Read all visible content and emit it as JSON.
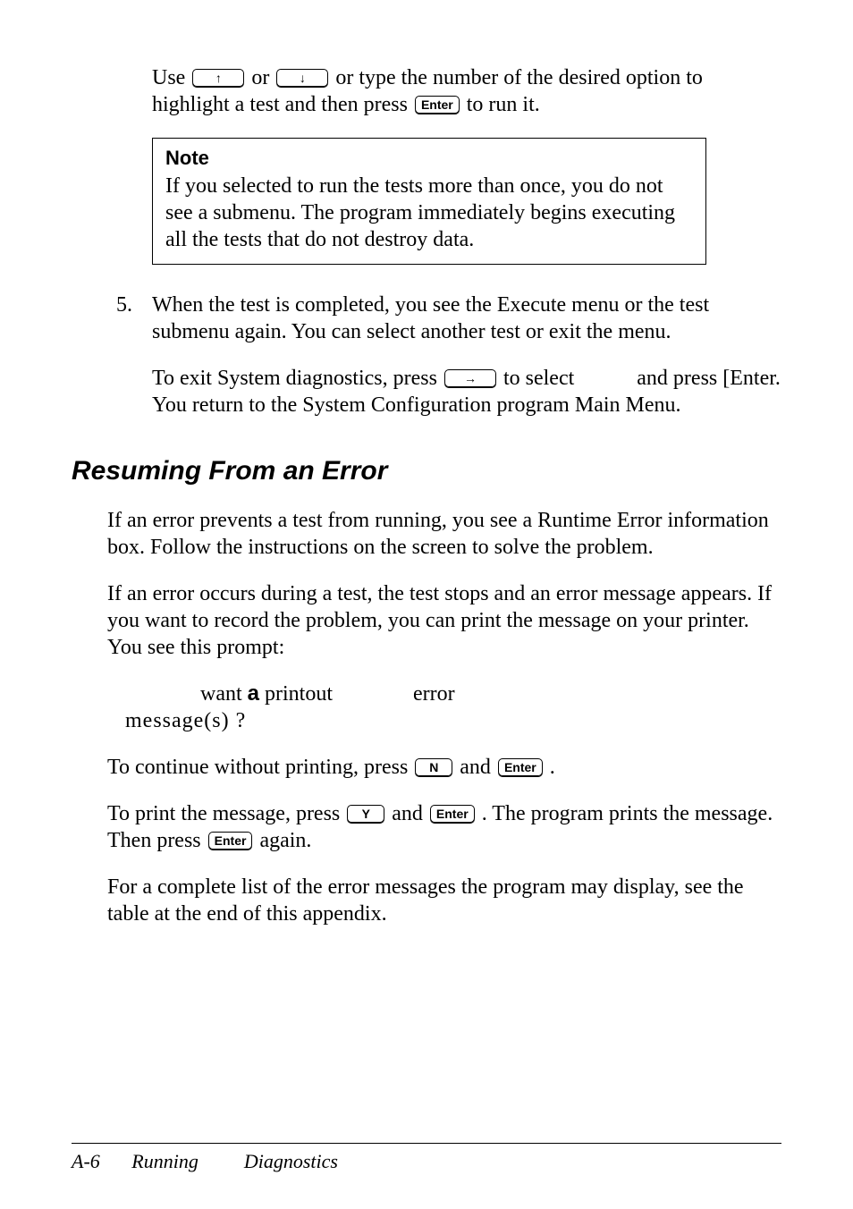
{
  "intro": {
    "line1_a": "Use ",
    "line1_b": " or ",
    "line1_c": " or type the number of the desired option to highlight a test and then press ",
    "line1_d": " to run it."
  },
  "keys": {
    "up": "↑",
    "down": "↓",
    "right": "→",
    "enter": "Enter",
    "N": "N",
    "Y": "Y"
  },
  "note": {
    "title": "Note",
    "body": "If you selected to run the tests more than once, you do not see a submenu. The program immediately begins executing all the tests that do not destroy data."
  },
  "step5": {
    "num": "5.",
    "p1": "When the test is completed, you see the Execute menu or the test submenu again. You can select another test or exit the menu.",
    "p2_a": "To exit System diagnostics, press ",
    "p2_b": "  to select",
    "p2_c": "and press [Enter. You return to the System Configuration program Main Menu."
  },
  "section": "Resuming From an Error",
  "err": {
    "p1": "If an error prevents a test from running, you see a Runtime Error information box. Follow the instructions on the screen to solve the problem.",
    "p2": "If an error occurs during a test, the test stops and an error message appears. If you want to record the problem, you can print the message on your printer. You see this prompt:",
    "prompt_a": "want ",
    "prompt_bold": "a",
    "prompt_b": " printout",
    "prompt_c": "error",
    "prompt_line2": "message(s)  ?",
    "p3_a": "To continue without printing, press ",
    "p3_b": " and ",
    "p3_c": ".",
    "p4_a": "To print the message, press ",
    "p4_b": " and ",
    "p4_c": ". The program prints the message. Then press ",
    "p4_d": " again.",
    "p5": "For a complete list of the error messages the program may display, see the table at the end of this appendix."
  },
  "footer": {
    "page": "A-6",
    "title_a": "Running",
    "title_b": "Diagnostics"
  }
}
